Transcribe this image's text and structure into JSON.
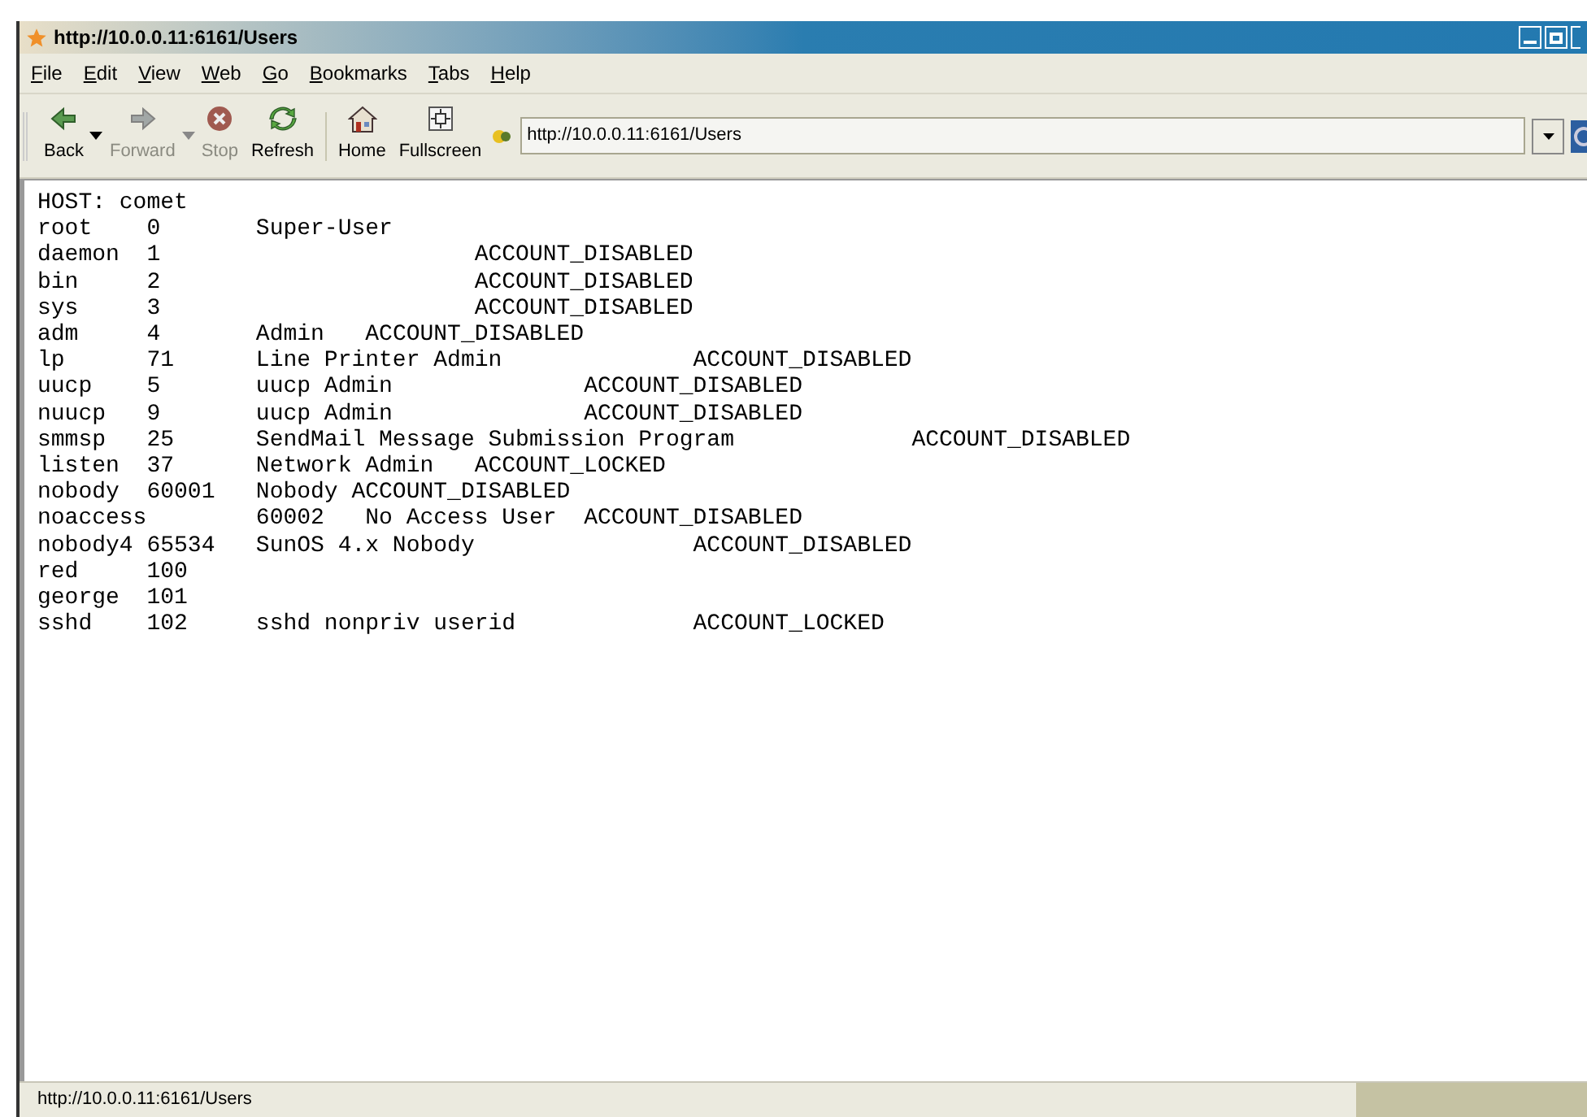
{
  "window": {
    "title": "http://10.0.0.11:6161/Users"
  },
  "menu": [
    {
      "label": "File"
    },
    {
      "label": "Edit"
    },
    {
      "label": "View"
    },
    {
      "label": "Web"
    },
    {
      "label": "Go"
    },
    {
      "label": "Bookmarks"
    },
    {
      "label": "Tabs"
    },
    {
      "label": "Help"
    }
  ],
  "toolbar": [
    {
      "kind": "back",
      "label": "Back",
      "disabled": false,
      "dropdown": true
    },
    {
      "kind": "forward",
      "label": "Forward",
      "disabled": true,
      "dropdown": true
    },
    {
      "kind": "stop",
      "label": "Stop",
      "disabled": true,
      "dropdown": false
    },
    {
      "kind": "refresh",
      "label": "Refresh",
      "disabled": false,
      "dropdown": false
    },
    {
      "kind": "home",
      "label": "Home",
      "disabled": false,
      "dropdown": false
    },
    {
      "kind": "fullscreen",
      "label": "Fullscreen",
      "disabled": false,
      "dropdown": false
    }
  ],
  "address": {
    "value": "http://10.0.0.11:6161/Users"
  },
  "page_lines": [
    "HOST: comet",
    "root\t0\tSuper-User",
    "daemon\t1\t\t\tACCOUNT_DISABLED",
    "bin\t2\t\t\tACCOUNT_DISABLED",
    "sys\t3\t\t\tACCOUNT_DISABLED",
    "adm\t4\tAdmin\tACCOUNT_DISABLED",
    "lp\t71\tLine Printer Admin\t\tACCOUNT_DISABLED",
    "uucp\t5\tuucp Admin\t\tACCOUNT_DISABLED",
    "nuucp\t9\tuucp Admin\t\tACCOUNT_DISABLED",
    "smmsp\t25\tSendMail Message Submission Program\t\tACCOUNT_DISABLED",
    "listen\t37\tNetwork Admin\tACCOUNT_LOCKED",
    "nobody\t60001\tNobody ACCOUNT_DISABLED",
    "noaccess\t60002\tNo Access User\tACCOUNT_DISABLED",
    "nobody4 65534\tSunOS 4.x Nobody\t\tACCOUNT_DISABLED",
    "red\t100",
    "george\t101",
    "sshd\t102\tsshd nonpriv userid\t\tACCOUNT_LOCKED"
  ],
  "status_bar": "http://10.0.0.11:6161/Users"
}
